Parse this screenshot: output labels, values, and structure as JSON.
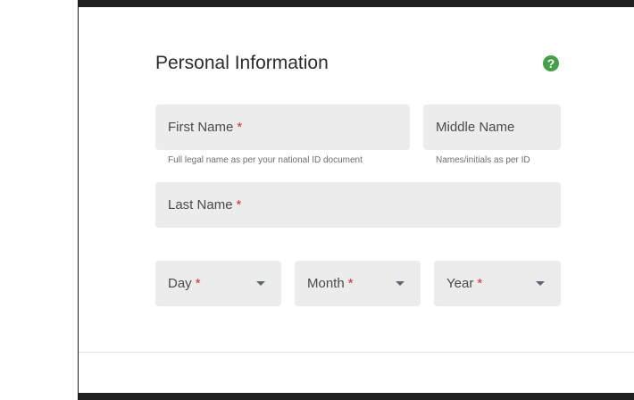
{
  "section": {
    "title": "Personal Information",
    "help_icon": "question-circle-icon",
    "accent_color": "#43a047"
  },
  "fields": {
    "first_name": {
      "label": "First Name",
      "required_mark": "*",
      "hint": "Full legal name as per your national ID document"
    },
    "middle_name": {
      "label": "Middle Name",
      "hint": "Names/initials as per ID"
    },
    "last_name": {
      "label": "Last Name",
      "required_mark": "*"
    },
    "day": {
      "label": "Day",
      "required_mark": "*"
    },
    "month": {
      "label": "Month",
      "required_mark": "*"
    },
    "year": {
      "label": "Year",
      "required_mark": "*"
    }
  },
  "colors": {
    "field_background": "#ececec",
    "required_color": "#d32f2f"
  }
}
